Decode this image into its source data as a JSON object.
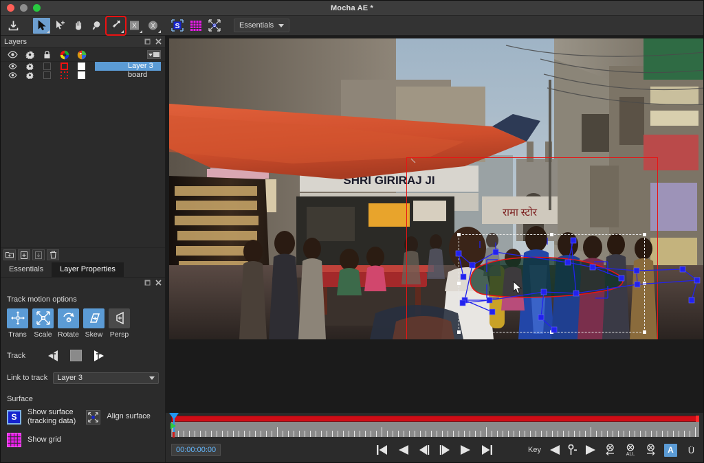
{
  "window": {
    "title": "Mocha AE *",
    "traffic_lights": [
      "close",
      "minimize",
      "zoom"
    ]
  },
  "toolbar": {
    "items": [
      {
        "name": "save-export-icon",
        "label": "Save / Export",
        "state": "normal"
      },
      {
        "name": "select-tool-icon",
        "label": "Pick / Select",
        "state": "selected"
      },
      {
        "name": "add-point-tool-icon",
        "label": "Add Point",
        "state": "normal"
      },
      {
        "name": "pan-hand-tool-icon",
        "label": "Pan",
        "state": "normal"
      },
      {
        "name": "zoom-magnifier-icon",
        "label": "Zoom",
        "state": "normal"
      },
      {
        "name": "link-to-track-tool-icon",
        "label": "Link Layer to Track",
        "state": "highlighted"
      },
      {
        "name": "x-spline-tool-icon",
        "label": "Create X-Spline Layer",
        "state": "normal"
      },
      {
        "name": "bezier-spline-tool-icon",
        "label": "Create Bezier Layer",
        "state": "normal"
      },
      {
        "name": "show-surface-icon",
        "label": "Show Surface",
        "state": "active"
      },
      {
        "name": "show-grid-icon",
        "label": "Show Grid",
        "state": "active"
      },
      {
        "name": "align-surface-icon",
        "label": "Align Surface",
        "state": "normal"
      }
    ],
    "workspace": {
      "label": "Essentials",
      "caret": "chevron-down-icon"
    }
  },
  "layers_panel": {
    "title": "Layers",
    "header_icons": [
      "float-panel-icon",
      "close-panel-icon"
    ],
    "columns": [
      {
        "name": "eye-icon",
        "tooltip": "Visible"
      },
      {
        "name": "gear-icon",
        "tooltip": "Settings"
      },
      {
        "name": "lock-icon",
        "tooltip": "Lock"
      },
      {
        "name": "color-wheel-icon",
        "tooltip": "Outline Color"
      },
      {
        "name": "color-palette-icon",
        "tooltip": "Fill Color"
      }
    ],
    "menu_button": "layer-options-menu-icon",
    "rows": [
      {
        "name": "Layer 3",
        "selected": true,
        "visible": true,
        "locked": false,
        "outline": "#ee1111",
        "fill": "#ffffff"
      },
      {
        "name": "board",
        "selected": false,
        "visible": true,
        "locked": false,
        "outline": "#ee1111",
        "fill": "#ffffff"
      }
    ],
    "tools": [
      {
        "name": "new-folder-icon",
        "label": "New Group"
      },
      {
        "name": "add-layer-icon",
        "label": "Add Layer"
      },
      {
        "name": "merge-layer-icon",
        "label": "Merge Layer"
      },
      {
        "name": "delete-layer-icon",
        "label": "Delete Layer"
      }
    ]
  },
  "tabs": [
    {
      "label": "Essentials",
      "active": false
    },
    {
      "label": "Layer Properties",
      "active": true
    }
  ],
  "properties": {
    "header_icons": [
      "float-panel-icon",
      "close-panel-icon"
    ],
    "track_motion": {
      "title": "Track motion options",
      "options": [
        {
          "label": "Trans",
          "icon": "translate-icon",
          "active": true
        },
        {
          "label": "Scale",
          "icon": "scale-icon",
          "active": true
        },
        {
          "label": "Rotate",
          "icon": "rotate-icon",
          "active": true
        },
        {
          "label": "Skew",
          "icon": "skew-icon",
          "active": true
        },
        {
          "label": "Persp",
          "icon": "perspective-icon",
          "active": false
        }
      ]
    },
    "track": {
      "label": "Track",
      "back_icon": "track-backwards-icon",
      "stop_icon": "track-stop-icon",
      "forward_icon": "track-forwards-icon"
    },
    "link_to_track": {
      "label": "Link to track",
      "value": "Layer 3",
      "caret": "chevron-down-icon"
    },
    "surface": {
      "title": "Surface",
      "show_surface": {
        "label_line1": "Show surface",
        "label_line2": "(tracking data)",
        "icon": "surface-s-icon"
      },
      "align_surface": {
        "label": "Align surface",
        "icon": "align-surface-icon"
      },
      "show_grid": {
        "label": "Show grid",
        "icon": "grid-icon"
      }
    }
  },
  "viewer": {
    "roi_color": "#e81414",
    "spline_color": "#e81414",
    "control_point_color": "#2222ee",
    "surface_box_color": "#e8e8e8",
    "cursor": "arrow-cursor"
  },
  "timeline": {
    "timecode": "00:00:00:00",
    "bar_color": "#cf0d16",
    "playhead_color": "#2196f3",
    "transport": [
      {
        "name": "go-to-start-button",
        "label": "Go to Start"
      },
      {
        "name": "play-backwards-button",
        "label": "Play Backwards"
      },
      {
        "name": "step-backward-button",
        "label": "Step Back"
      },
      {
        "name": "step-forward-button",
        "label": "Step Forward"
      },
      {
        "name": "play-forward-button",
        "label": "Play Forward"
      },
      {
        "name": "go-to-end-button",
        "label": "Go to End"
      }
    ],
    "key_label": "Key",
    "key_controls": [
      {
        "name": "prev-keyframe-button",
        "label": "Previous Keyframe"
      },
      {
        "name": "add-keyframe-button",
        "label": "Add Keyframe"
      },
      {
        "name": "next-keyframe-button",
        "label": "Next Keyframe"
      },
      {
        "name": "delete-keyframes-backward-button",
        "label": "Delete Keyframes Backward"
      },
      {
        "name": "delete-all-keyframes-button",
        "label": "ALL"
      },
      {
        "name": "delete-keyframes-forward-button",
        "label": "Delete Keyframes Forward"
      },
      {
        "name": "auto-keyframe-toggle",
        "label": "A"
      },
      {
        "name": "undo-keyframe-button",
        "label": "Ü"
      }
    ]
  }
}
